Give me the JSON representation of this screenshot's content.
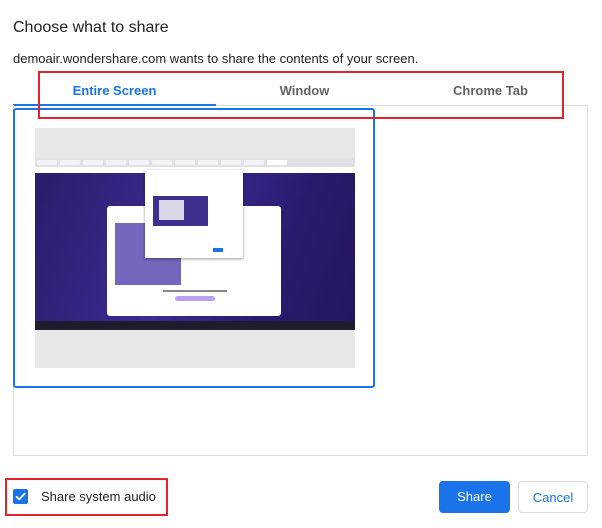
{
  "dialog": {
    "title": "Choose what to share",
    "subtitle": "demoair.wondershare.com wants to share the contents of your screen."
  },
  "tabs": [
    {
      "label": "Entire Screen",
      "active": true
    },
    {
      "label": "Window",
      "active": false
    },
    {
      "label": "Chrome Tab",
      "active": false
    }
  ],
  "sources": [
    {
      "type": "entire-screen",
      "selected": true
    }
  ],
  "audio": {
    "label": "Share system audio",
    "checked": true
  },
  "buttons": {
    "share": "Share",
    "cancel": "Cancel"
  },
  "colors": {
    "accent": "#1a73e8",
    "annotation": "#e0242b",
    "divider": "#dadce0"
  }
}
